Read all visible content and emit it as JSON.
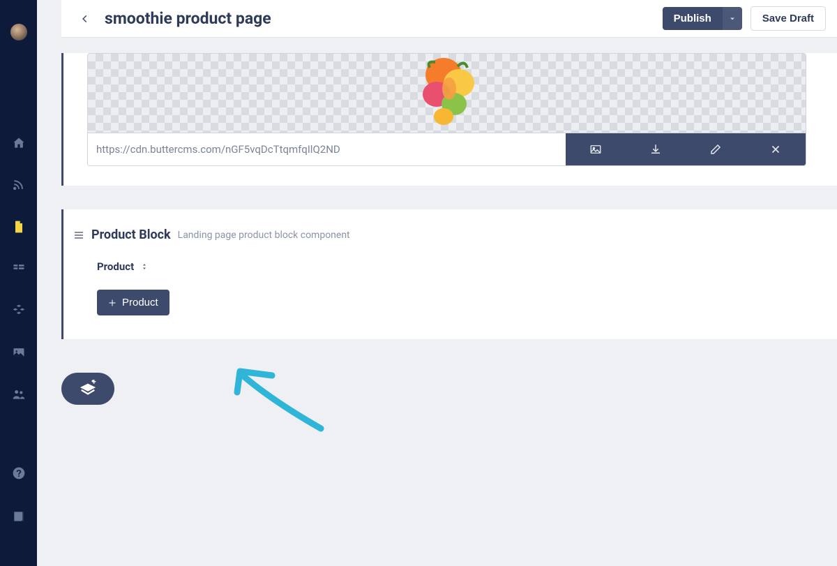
{
  "header": {
    "title": "smoothie product page",
    "publish_label": "Publish",
    "draft_label": "Save Draft"
  },
  "image_field": {
    "url": "https://cdn.buttercms.com/nGF5vqDcTtqmfqIlQ2ND",
    "actions": {
      "preview": "media-preview-icon",
      "download": "download-icon",
      "edit": "edit-icon",
      "remove": "close-icon"
    }
  },
  "product_block": {
    "title": "Product Block",
    "description": "Landing page product block component",
    "field_label": "Product",
    "add_button_label": "Product"
  },
  "sidebar": {
    "icons": [
      "home-icon",
      "blog-icon",
      "pages-icon",
      "collections-icon",
      "components-icon",
      "media-icon",
      "users-icon"
    ],
    "bottom_icons": [
      "help-icon",
      "docs-icon"
    ]
  },
  "colors": {
    "sidebar_bg": "#0e1a3a",
    "accent": "#3d4a6b",
    "active_icon": "#f5d547",
    "annotation": "#2fb5d8"
  }
}
